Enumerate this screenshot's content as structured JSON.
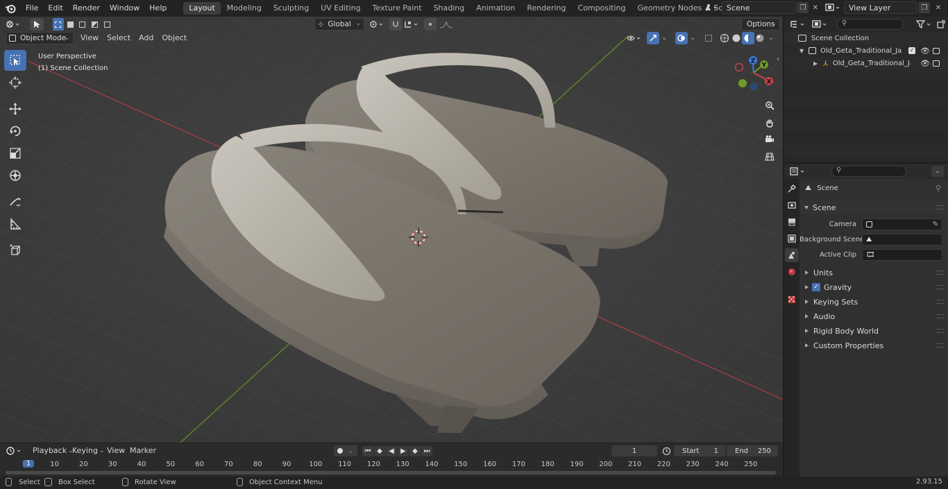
{
  "menu": {
    "items": [
      "File",
      "Edit",
      "Render",
      "Window",
      "Help"
    ]
  },
  "workspaces": {
    "tabs": [
      "Layout",
      "Modeling",
      "Sculpting",
      "UV Editing",
      "Texture Paint",
      "Shading",
      "Animation",
      "Rendering",
      "Compositing",
      "Geometry Nodes",
      "Scripting"
    ],
    "active": "Layout"
  },
  "scene": {
    "name": "Scene",
    "view_layer": "View Layer"
  },
  "viewport": {
    "mode": "Object Mode",
    "menus": [
      "View",
      "Select",
      "Add",
      "Object"
    ],
    "transform_orientation": "Global",
    "options_label": "Options",
    "overlay_line1": "User Perspective",
    "overlay_line2": "(1) Scene Collection"
  },
  "axes": {
    "x": "X",
    "y": "Y",
    "z": "Z"
  },
  "outliner": {
    "collection": "Scene Collection",
    "object_collection": "Old_Geta_Traditional_Japanes",
    "object": "Old_Geta_Traditional_Jap"
  },
  "properties": {
    "context": "Scene",
    "panel": "Scene",
    "camera_label": "Camera",
    "background_label": "Background Scene",
    "clip_label": "Active Clip",
    "subpanels": [
      "Units",
      "Gravity",
      "Keying Sets",
      "Audio",
      "Rigid Body World",
      "Custom Properties"
    ],
    "gravity_checked": true
  },
  "timeline": {
    "menus": [
      "Playback",
      "Keying",
      "View",
      "Marker"
    ],
    "current_frame": "1",
    "start_label": "Start",
    "start": "1",
    "end_label": "End",
    "end": "250",
    "ruler": [
      "1",
      "10",
      "20",
      "30",
      "40",
      "50",
      "60",
      "70",
      "80",
      "90",
      "100",
      "110",
      "120",
      "130",
      "140",
      "150",
      "160",
      "170",
      "180",
      "190",
      "200",
      "210",
      "220",
      "230",
      "240",
      "250"
    ]
  },
  "status": {
    "select": "Select",
    "box_select": "Box Select",
    "rotate": "Rotate View",
    "context_menu": "Object Context Menu",
    "version": "2.93.15"
  },
  "colors": {
    "accent": "#4772b3",
    "x_axis": "#c8424b",
    "y_axis": "#6e9b2a",
    "z_axis": "#3d7bd9"
  }
}
